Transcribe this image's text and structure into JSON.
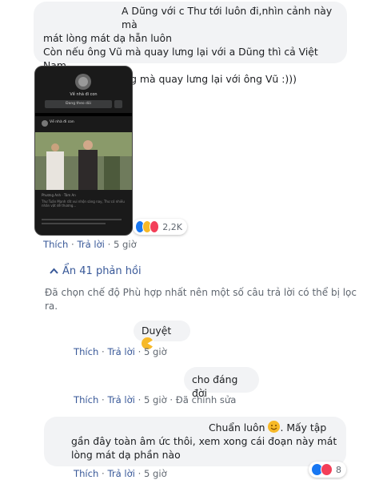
{
  "c1": {
    "lines": [
      "A Dũng với c Thư tới luôn đi,nhìn cảnh này mà",
      "mát lòng mát dạ hẵn luôn",
      "Còn nếu ông Vũ mà quay lưng lại với a Dũng thì cả Việt Nam",
      "sẽ đứng về a Dũng mà quay lưng lại với ông Vũ :)))"
    ],
    "reaction_count": "2,2K",
    "like": "Thích",
    "reply": "Trả lời",
    "time": "5 giờ"
  },
  "screenshot": {
    "name": "Về nhà đi con",
    "follow": "Đang theo dõi",
    "post_title": "Về nhà đi con",
    "text1": "Phương Anh · Tâm An",
    "text2": "Thư Tuấn Mạnh rất vui nhộn sáng nay, Thư có nhiều nhân vật dễ thương..."
  },
  "collapse": {
    "label": "Ẩn 41 phản hồi"
  },
  "filter_note": {
    "line1": "Đã chọn chế độ Phù hợp nhất nên một số câu trả lời có thể bị lọc",
    "line2": "ra."
  },
  "r1": {
    "text": "Duyệt",
    "like": "Thích",
    "reply": "Trả lời",
    "time": "5 giờ"
  },
  "r2": {
    "text": "cho đáng đời",
    "like": "Thích",
    "reply": "Trả lời",
    "time": "5 giờ",
    "edited": "Đã chỉnh sửa"
  },
  "r3": {
    "line1": "Chuẩn luôn",
    "line1b": ". Mấy tập",
    "line2": "gần đây toàn âm ức thôi, xem xong cái đoạn này mát",
    "line3": "lòng mát dạ phần nào",
    "reaction_count": "8",
    "like": "Thích",
    "reply": "Trả lời",
    "time": "5 giờ"
  },
  "colors": {
    "link": "#385898",
    "bubble": "#f2f3f5",
    "meta": "#606770"
  }
}
